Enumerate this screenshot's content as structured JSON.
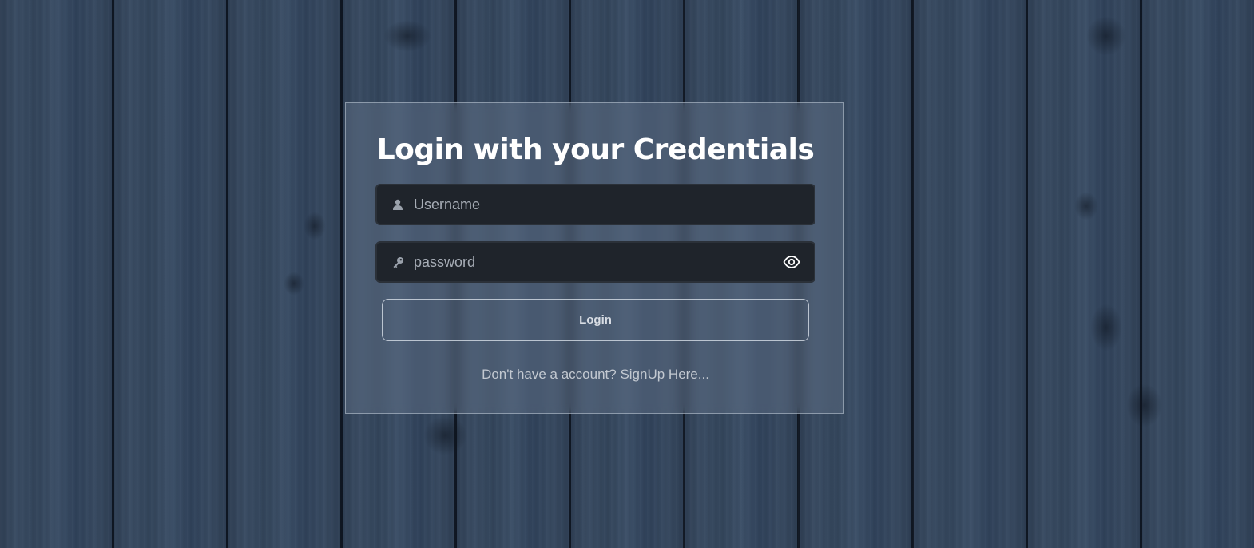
{
  "login": {
    "title": "Login with your Credentials",
    "username": {
      "placeholder": "Username",
      "value": ""
    },
    "password": {
      "placeholder": "password",
      "value": ""
    },
    "login_button_label": "Login",
    "signup_prompt": "Don't have a account?",
    "signup_link": "SignUp Here..."
  },
  "icons": {
    "username": "user-icon",
    "password": "key-icon",
    "toggle": "eye-icon"
  },
  "colors": {
    "input_bg": "#1f242b",
    "title_text": "#ffffff",
    "muted_text": "#c3c9d1",
    "card_border": "#dfe6ef"
  }
}
